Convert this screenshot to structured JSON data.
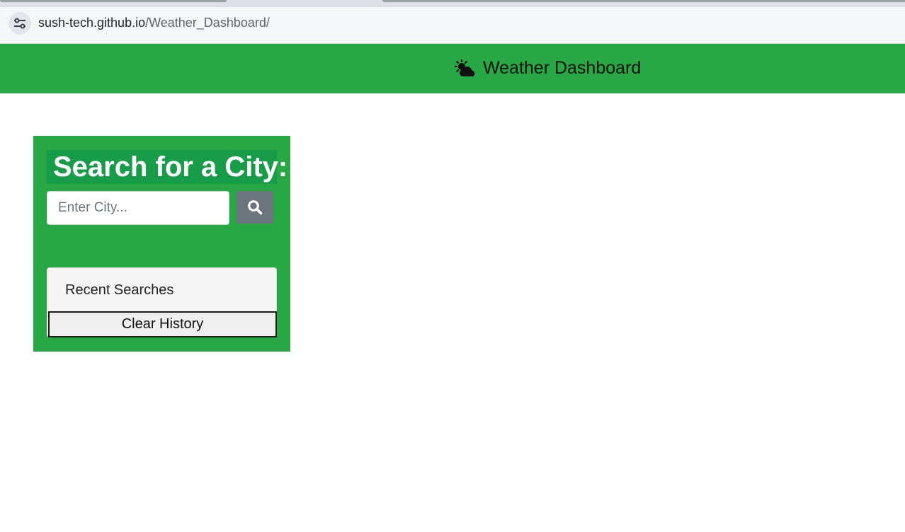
{
  "browser": {
    "url_host": "sush-tech.github.io",
    "url_path": "/Weather_Dashboard/",
    "site_info_icon": "tune-icon"
  },
  "header": {
    "icon": "cloud-sun-icon",
    "title": "Weather Dashboard",
    "background": "#28a745"
  },
  "search_panel": {
    "heading": "Search for a City:",
    "input_placeholder": "Enter City...",
    "input_value": "",
    "search_button_icon": "search-icon",
    "button_color": "#6c757d"
  },
  "recent_searches": {
    "title": "Recent Searches",
    "items": [],
    "clear_label": "Clear History"
  }
}
